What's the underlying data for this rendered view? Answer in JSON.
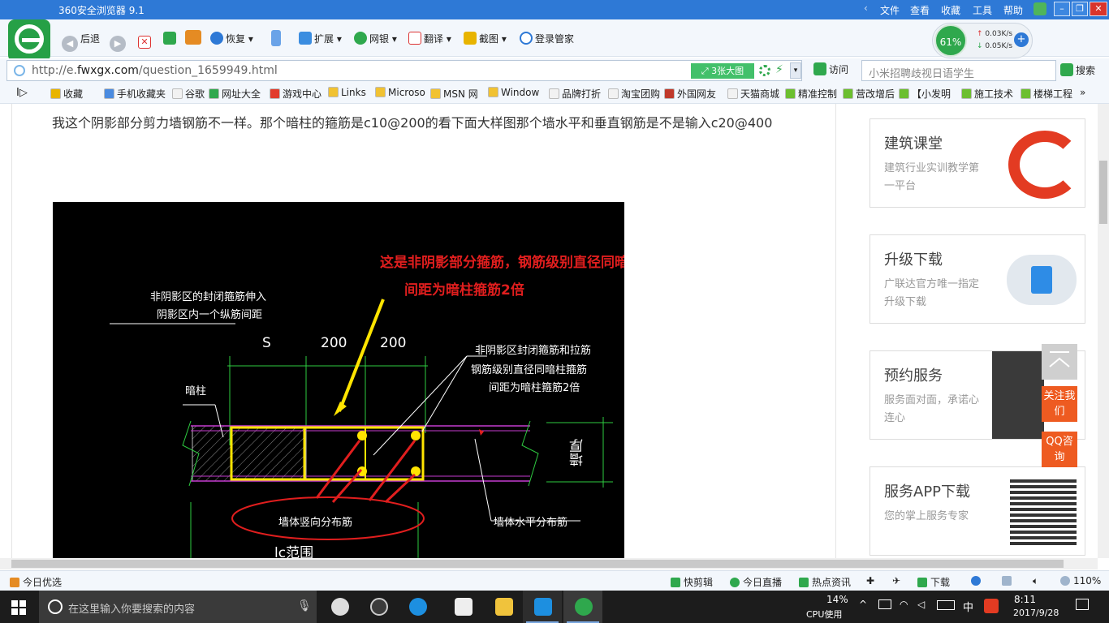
{
  "browser": {
    "title": "360安全浏览器 9.1",
    "menus": [
      "文件",
      "查看",
      "收藏",
      "工具",
      "帮助"
    ]
  },
  "toolbar": {
    "back_label": "后退",
    "restore_label": "恢复",
    "extend_label": "扩展",
    "bank_label": "网银",
    "translate_label": "翻译",
    "screenshot_label": "截图",
    "manager_label": "登录管家"
  },
  "cpu_widget": {
    "percent": "61%",
    "up_speed": "0.03K/s",
    "down_speed": "0.05K/s"
  },
  "address": {
    "scheme": "http://e.",
    "domain": "fwxgx.com",
    "path": "/question_1659949.html",
    "bigpic_label": "3张大图",
    "visit_label": "访问",
    "search_placeholder": "小米招聘歧视日语学生",
    "search_label": "搜索"
  },
  "bookmarks": [
    {
      "label": "收藏",
      "color": "#e8b400"
    },
    {
      "label": "手机收藏夹",
      "color": "#4a8be0"
    },
    {
      "label": "谷歌",
      "color": "#f2f2f2"
    },
    {
      "label": "网址大全",
      "color": "#2fa84d"
    },
    {
      "label": "游戏中心",
      "color": "#e23c2c"
    },
    {
      "label": "Links",
      "color": "#f1c232"
    },
    {
      "label": "Microso",
      "color": "#f1c232"
    },
    {
      "label": "MSN 网",
      "color": "#f1c232"
    },
    {
      "label": "Window",
      "color": "#f1c232"
    },
    {
      "label": "品牌打折",
      "color": "#f2f2f2"
    },
    {
      "label": "淘宝团购",
      "color": "#f2f2f2"
    },
    {
      "label": "外国网友",
      "color": "#c0392b"
    },
    {
      "label": "天猫商城",
      "color": "#f2f2f2"
    },
    {
      "label": "精准控制",
      "color": "#6cbf2f"
    },
    {
      "label": "营改增后",
      "color": "#6cbf2f"
    },
    {
      "label": "【小发明",
      "color": "#6cbf2f"
    },
    {
      "label": "施工技术",
      "color": "#6cbf2f"
    },
    {
      "label": "楼梯工程",
      "color": "#6cbf2f"
    }
  ],
  "page": {
    "question": "我这个阴影部分剪力墙钢筋不一样。那个暗柱的箍筋是c10@200的看下面大样图那个墙水平和垂直钢筋是不是输入c20@400",
    "cad": {
      "red_note_line1": "这是非阴影部分箍筋，钢筋级别直径同暗柱箍筋",
      "red_note_line2": "间距为暗柱箍筋2倍",
      "label_nonshadow_1": "非阴影区的封闭箍筋伸入",
      "label_nonshadow_2": "阴影区内一个纵筋间距",
      "dim_s": "S",
      "dim_200a": "200",
      "dim_200b": "200",
      "label_closed_1": "非阴影区封闭箍筋和拉筋",
      "label_closed_2": "钢筋级别直径同暗柱箍筋",
      "label_closed_3": "间距为暗柱箍筋2倍",
      "label_anzhu": "暗柱",
      "label_wall_thick": "墙厚",
      "label_vertical": "墙体竖向分布筋",
      "label_horizontal": "墙体水平分布筋",
      "label_lc": "lc范围"
    }
  },
  "sidebar": {
    "cards": [
      {
        "title": "建筑课堂",
        "sub": "建筑行业实训教学第一平台"
      },
      {
        "title": "升级下载",
        "sub": "广联达官方唯一指定升级下载"
      },
      {
        "title": "预约服务",
        "sub": "服务面对面，承诺心连心"
      },
      {
        "title": "服务APP下载",
        "sub": "您的掌上服务专家"
      }
    ],
    "follow_label": "关注我们",
    "qq_label": "QQ咨询"
  },
  "statusbar": {
    "left": "今日优选",
    "items": [
      "快剪辑",
      "今日直播",
      "热点资讯",
      "下载"
    ],
    "zoom": "110%"
  },
  "taskbar": {
    "search_placeholder": "在这里输入你要搜索的内容",
    "cpu_percent": "14%",
    "cpu_label": "CPU使用",
    "ime": "中",
    "time": "8:11",
    "date": "2017/9/28"
  }
}
